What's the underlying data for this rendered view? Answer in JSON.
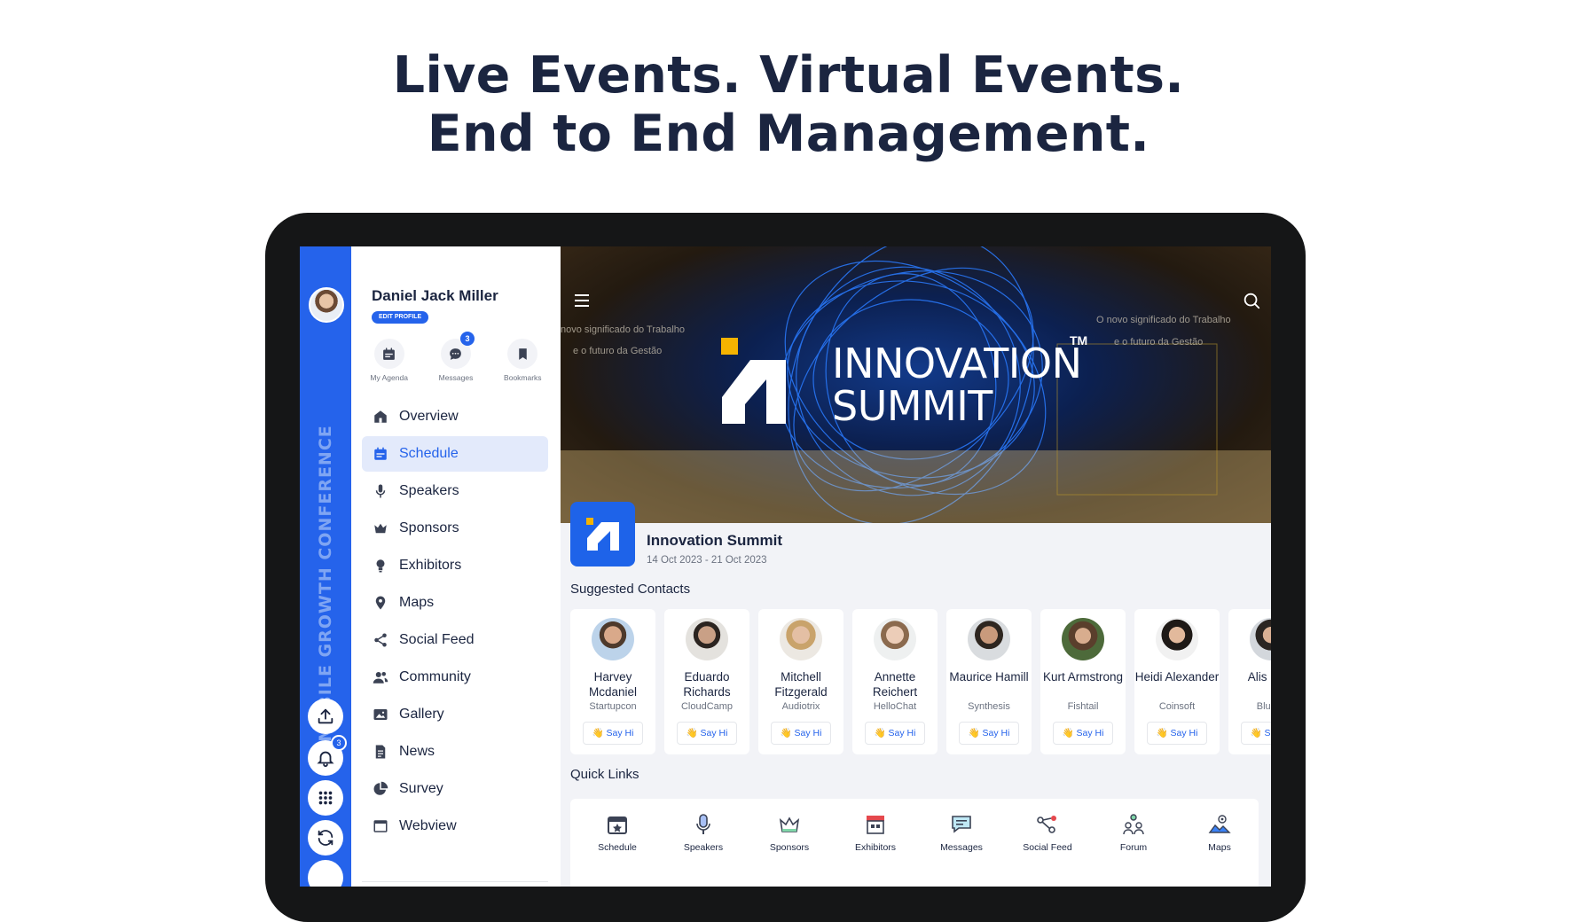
{
  "headline": {
    "line1": "Live Events. Virtual Events.",
    "line2": "End to End Management."
  },
  "rail": {
    "vertical_text": "MOBILE GROWTH CONFERENCE",
    "notification_count": "3"
  },
  "profile": {
    "name": "Daniel Jack Miller",
    "edit_label": "EDIT PROFILE"
  },
  "shortcuts": [
    {
      "label": "My Agenda",
      "icon": "calendar-icon"
    },
    {
      "label": "Messages",
      "icon": "chat-icon",
      "badge": "3"
    },
    {
      "label": "Bookmarks",
      "icon": "bookmark-icon"
    }
  ],
  "menu": [
    {
      "label": "Overview",
      "icon": "home-icon"
    },
    {
      "label": "Schedule",
      "icon": "calendar-icon",
      "active": true
    },
    {
      "label": "Speakers",
      "icon": "microphone-icon"
    },
    {
      "label": "Sponsors",
      "icon": "crown-icon"
    },
    {
      "label": "Exhibitors",
      "icon": "lightbulb-icon"
    },
    {
      "label": "Maps",
      "icon": "map-pin-icon"
    },
    {
      "label": "Social Feed",
      "icon": "share-icon"
    },
    {
      "label": "Community",
      "icon": "people-icon"
    },
    {
      "label": "Gallery",
      "icon": "image-icon"
    },
    {
      "label": "News",
      "icon": "document-icon"
    },
    {
      "label": "Survey",
      "icon": "pie-chart-icon"
    },
    {
      "label": "Webview",
      "icon": "browser-icon"
    }
  ],
  "banner": {
    "logo_line1": "INNOVATION",
    "logo_line2": "SUMMIT",
    "tm": "TM",
    "bg_left_1": "novo significado do Trabalho",
    "bg_left_2": "e o futuro da Gestão",
    "bg_right_1": "O novo significado do Trabalho",
    "bg_right_2": "e o futuro da Gestão"
  },
  "event": {
    "name": "Innovation Summit",
    "dates": "14 Oct 2023 - 21 Oct 2023"
  },
  "suggested_title": "Suggested Contacts",
  "say_hi_label": "Say Hi",
  "contacts": [
    {
      "name": "Harvey Mcdaniel",
      "company": "Startupcon"
    },
    {
      "name": "Eduardo Richards",
      "company": "CloudCamp"
    },
    {
      "name": "Mitchell Fitzgerald",
      "company": "Audiotrix"
    },
    {
      "name": "Annette Reichert",
      "company": "HelloChat"
    },
    {
      "name": "Maurice Hamill",
      "company": "Synthesis"
    },
    {
      "name": "Kurt Armstrong",
      "company": "Fishtail"
    },
    {
      "name": "Heidi Alexander",
      "company": "Coinsoft"
    },
    {
      "name": "Alis Smit",
      "company": "Blue S"
    }
  ],
  "quick_links_title": "Quick Links",
  "quick_links": [
    {
      "label": "Schedule",
      "icon": "calendar-star-icon"
    },
    {
      "label": "Speakers",
      "icon": "microphone-icon"
    },
    {
      "label": "Sponsors",
      "icon": "crown-icon"
    },
    {
      "label": "Exhibitors",
      "icon": "storefront-icon"
    },
    {
      "label": "Messages",
      "icon": "chat-icon"
    },
    {
      "label": "Social Feed",
      "icon": "share-icon"
    },
    {
      "label": "Forum",
      "icon": "people-icon"
    },
    {
      "label": "Maps",
      "icon": "map-icon"
    }
  ],
  "colors": {
    "brand": "#2563eb",
    "headline": "#1b2540",
    "active_bg": "#e3eafb",
    "accent_yellow": "#f5b300"
  }
}
